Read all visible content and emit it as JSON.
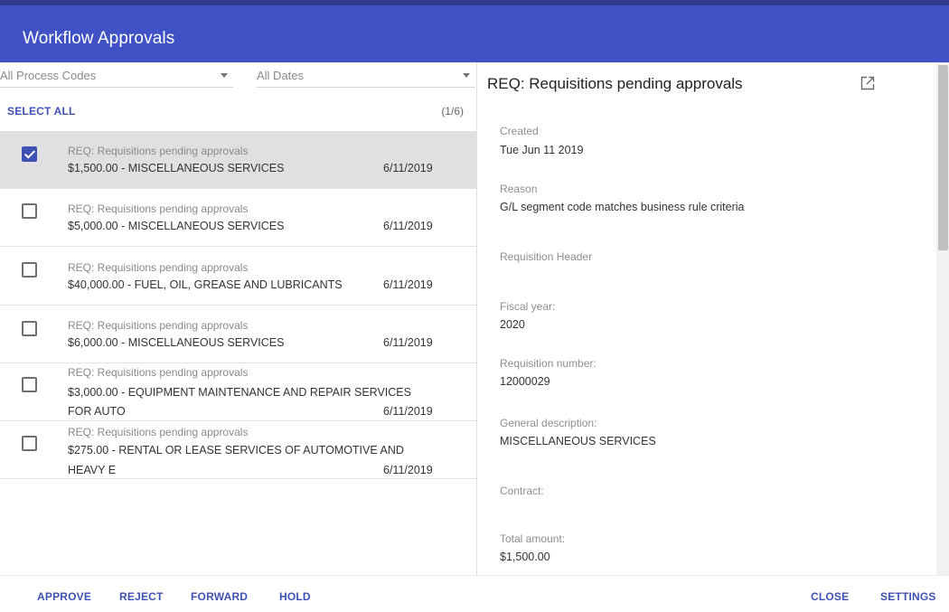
{
  "window": {
    "title": "Workflow Approvals"
  },
  "filters": {
    "process_code": "All Process Codes",
    "dates": "All Dates"
  },
  "list": {
    "select_all_label": "SELECT ALL",
    "count": "(1/6)",
    "items": [
      {
        "checked": true,
        "title": "REQ: Requisitions pending approvals",
        "line2": "$1,500.00 - MISCELLANEOUS SERVICES",
        "line3": "",
        "date": "6/11/2019"
      },
      {
        "checked": false,
        "title": "REQ: Requisitions pending approvals",
        "line2": "$5,000.00 - MISCELLANEOUS SERVICES",
        "line3": "",
        "date": "6/11/2019"
      },
      {
        "checked": false,
        "title": "REQ: Requisitions pending approvals",
        "line2": "$40,000.00 - FUEL, OIL, GREASE AND LUBRICANTS",
        "line3": "",
        "date": "6/11/2019"
      },
      {
        "checked": false,
        "title": "REQ: Requisitions pending approvals",
        "line2": "$6,000.00 - MISCELLANEOUS SERVICES",
        "line3": "",
        "date": "6/11/2019"
      },
      {
        "checked": false,
        "title": "REQ: Requisitions pending approvals",
        "line2": "$3,000.00 - EQUIPMENT MAINTENANCE AND REPAIR SERVICES",
        "line3": "FOR AUTO",
        "date": "6/11/2019"
      },
      {
        "checked": false,
        "title": "REQ: Requisitions pending approvals",
        "line2": "$275.00 - RENTAL OR LEASE SERVICES OF AUTOMOTIVE AND",
        "line3": "HEAVY E",
        "date": "6/11/2019"
      }
    ]
  },
  "detail": {
    "title": "REQ: Requisitions pending approvals",
    "icons": {
      "open": "open-in-new-icon"
    },
    "fields": [
      {
        "label": "Created",
        "value": "Tue Jun 11 2019"
      },
      {
        "label": "Reason",
        "value": "G/L segment code matches business rule criteria"
      },
      {
        "label": "Requisition Header",
        "value": ""
      },
      {
        "label": "Fiscal year:",
        "value": "2020"
      },
      {
        "label": "Requisition number:",
        "value": "12000029"
      },
      {
        "label": "General description:",
        "value": "MISCELLANEOUS SERVICES"
      },
      {
        "label": "Contract:",
        "value": ""
      },
      {
        "label": "Total amount:",
        "value": "$1,500.00"
      }
    ]
  },
  "footer": {
    "approve": "APPROVE",
    "reject": "REJECT",
    "forward": "FORWARD",
    "hold": "HOLD",
    "close": "CLOSE",
    "settings": "SETTINGS"
  },
  "colors": {
    "header": "#3f51c5",
    "accent": "#3f51b5",
    "selected_row": "#e0e0e0"
  }
}
